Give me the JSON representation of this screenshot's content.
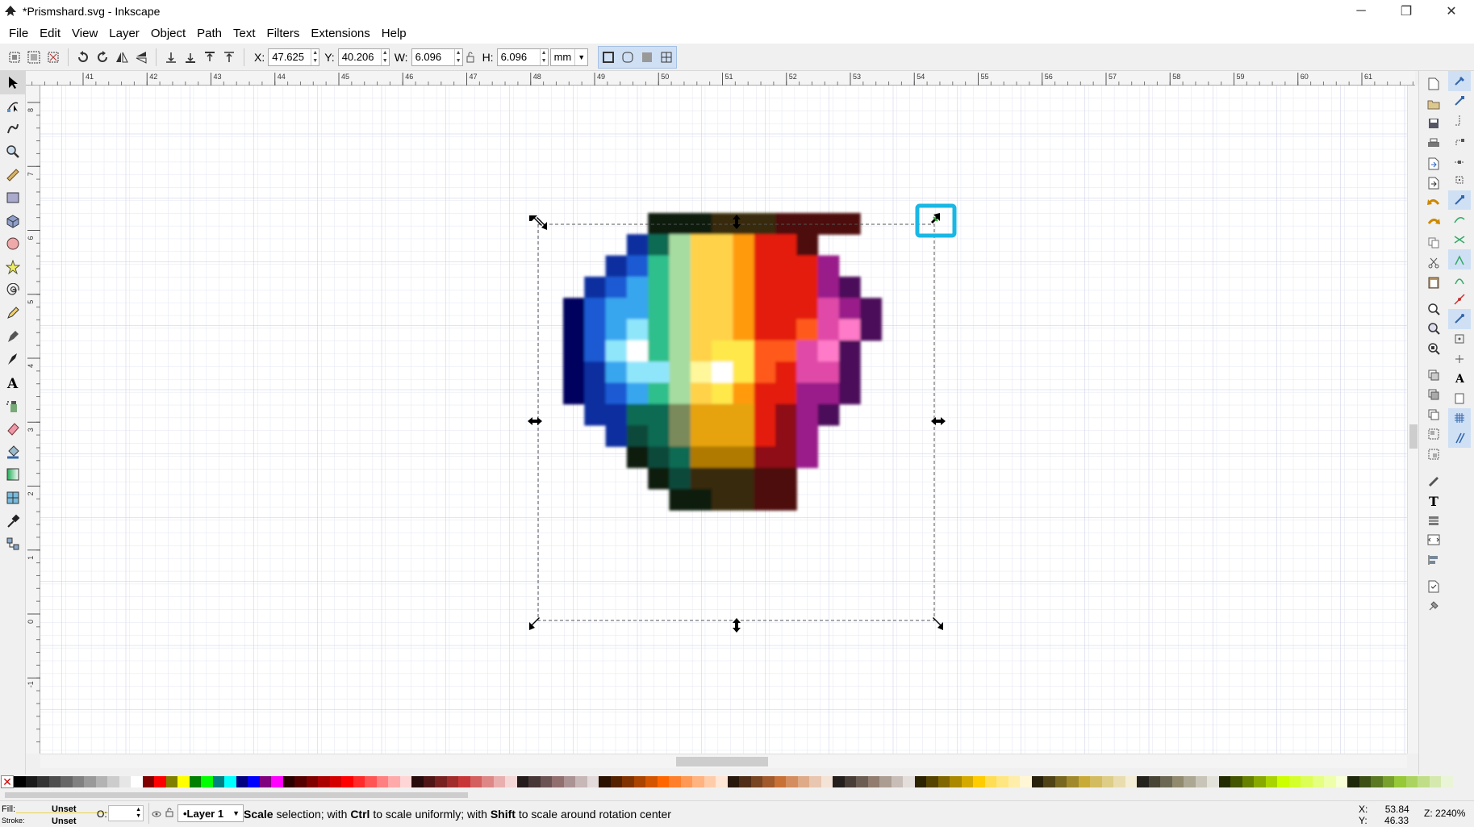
{
  "window": {
    "title": "*Prismshard.svg - Inkscape",
    "controls": {
      "minimize": "─",
      "restore": "❐",
      "close": "✕"
    }
  },
  "menu": [
    "File",
    "Edit",
    "View",
    "Layer",
    "Object",
    "Path",
    "Text",
    "Filters",
    "Extensions",
    "Help"
  ],
  "toolbar": {
    "x_label": "X:",
    "x_value": "47.625",
    "y_label": "Y:",
    "y_value": "40.206",
    "w_label": "W:",
    "w_value": "6.096",
    "h_label": "H:",
    "h_value": "6.096",
    "unit": "mm"
  },
  "rulers": {
    "top": [
      "41",
      "42",
      "43",
      "44",
      "45",
      "46",
      "47",
      "48",
      "49",
      "50",
      "51",
      "52",
      "53",
      "54",
      "55",
      "56",
      "57",
      "58",
      "59",
      "60",
      "61"
    ],
    "left": [
      "8",
      "7",
      "6",
      "5",
      "4",
      "3",
      "2",
      "1",
      "0",
      "-1"
    ]
  },
  "palette": {
    "none_symbol": "✕",
    "colors": [
      "#000000",
      "#1a1a1a",
      "#333333",
      "#4d4d4d",
      "#666666",
      "#808080",
      "#999999",
      "#b3b3b3",
      "#cccccc",
      "#e6e6e6",
      "#ffffff",
      "#800000",
      "#ff0000",
      "#808000",
      "#ffff00",
      "#008000",
      "#00ff00",
      "#008080",
      "#00ffff",
      "#000080",
      "#0000ff",
      "#800080",
      "#ff00ff",
      "#2b0000",
      "#550000",
      "#800000",
      "#aa0000",
      "#d40000",
      "#ff0000",
      "#ff2a2a",
      "#ff5555",
      "#ff8080",
      "#ffaaaa",
      "#ffd5d5",
      "#280b0b",
      "#501616",
      "#782121",
      "#a02c2c",
      "#c83737",
      "#d35f5f",
      "#de8787",
      "#e9afaf",
      "#f4d7d7",
      "#241c1c",
      "#483737",
      "#6c5353",
      "#916f6f",
      "#ac9393",
      "#c8b7b7",
      "#e3dbdb",
      "#2b1100",
      "#552200",
      "#803300",
      "#aa4400",
      "#d45500",
      "#ff6600",
      "#ff7f2a",
      "#ff9955",
      "#ffb380",
      "#ffccaa",
      "#ffe6d5",
      "#28170b",
      "#502d16",
      "#784421",
      "#a05a2c",
      "#c87137",
      "#d38d5f",
      "#deaa87",
      "#e9c6af",
      "#f4e3d7",
      "#241f1c",
      "#483e37",
      "#6c5d53",
      "#917c6f",
      "#ac9d93",
      "#c8beb7",
      "#e3dedb",
      "#2b2200",
      "#554400",
      "#806600",
      "#aa8800",
      "#d4aa00",
      "#ffcc00",
      "#ffdd55",
      "#ffe680",
      "#ffeeaa",
      "#fff6d5",
      "#28220b",
      "#504416",
      "#786721",
      "#a0892c",
      "#c8ab37",
      "#d3bc5f",
      "#decd87",
      "#e9ddaf",
      "#f4eed7",
      "#24221c",
      "#484537",
      "#6c6753",
      "#918a6f",
      "#aca793",
      "#c8c4b7",
      "#e3e2db",
      "#222b00",
      "#445500",
      "#668000",
      "#88aa00",
      "#aad400",
      "#ccff00",
      "#d4ff2a",
      "#ddff55",
      "#e5ff80",
      "#eeffaa",
      "#f6ffd5",
      "#1e280b",
      "#3c5016",
      "#5a7821",
      "#78a02c",
      "#96c837",
      "#abd35f",
      "#c0de87",
      "#d5e9af",
      "#eaf4d7"
    ]
  },
  "status": {
    "fill_label": "Fill:",
    "fill_value": "Unset",
    "stroke_label": "Stroke:",
    "stroke_value": "Unset",
    "opacity_label": "O:",
    "layer": "•Layer 1",
    "message_pre": "Scale",
    "message_1": " selection; with ",
    "message_ctrl": "Ctrl",
    "message_2": " to scale uniformly; with ",
    "message_shift": "Shift",
    "message_3": " to scale around rotation center",
    "cursor_x_label": "X:",
    "cursor_x": "53.84",
    "cursor_y_label": "Y:",
    "cursor_y": "46.33",
    "zoom_label": "Z:",
    "zoom_value": "2240%"
  }
}
